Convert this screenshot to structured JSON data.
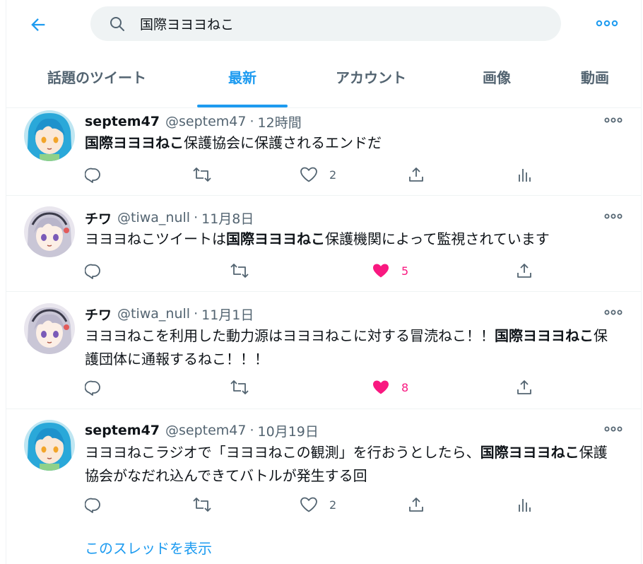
{
  "search": {
    "query": "国際ヨヨヨねこ"
  },
  "tabs": [
    "話題のツイート",
    "最新",
    "アカウント",
    "画像",
    "動画"
  ],
  "active_tab": "最新",
  "colors": {
    "accent": "#1d9bf0",
    "like": "#f91880",
    "secondary_text": "#536471",
    "divider": "#eff3f4"
  },
  "tweets": [
    {
      "name": "septem47",
      "handle": "@septem47",
      "dot": "·",
      "time": "12時間",
      "avatar": "blue-hair-character-avatar",
      "text_bold": "国際ヨヨヨねこ",
      "text_after": "保護協会に保護されるエンドだ",
      "likes": "2",
      "liked": false
    },
    {
      "name": "チワ",
      "handle": "@tiwa_null",
      "dot": "·",
      "time": "11月8日",
      "avatar": "silver-hair-character-avatar",
      "text_before": "ヨヨヨねこツイートは",
      "text_bold": "国際ヨヨヨねこ",
      "text_after": "保護機関によって監視されています",
      "likes": "5",
      "liked": true
    },
    {
      "name": "チワ",
      "handle": "@tiwa_null",
      "dot": "·",
      "time": "11月1日",
      "avatar": "silver-hair-character-avatar",
      "text_before": "ヨヨヨねこを利用した動力源はヨヨヨねこに対する冒涜ねこ！！",
      "text_bold": "国際ヨヨヨねこ",
      "text_after": "保護団体に通報するねこ！！！",
      "likes": "8",
      "liked": true
    },
    {
      "name": "septem47",
      "handle": "@septem47",
      "dot": "·",
      "time": "10月19日",
      "avatar": "blue-hair-character-avatar",
      "text_before": "ヨヨヨねこラジオで「ヨヨヨねこの観測」を行おうとしたら、",
      "text_bold": "国際ヨヨヨねこ",
      "text_after": "保護協会がなだれ込んできてバトルが発生する回",
      "likes": "2",
      "liked": false
    }
  ],
  "show_thread": "このスレッドを表示"
}
